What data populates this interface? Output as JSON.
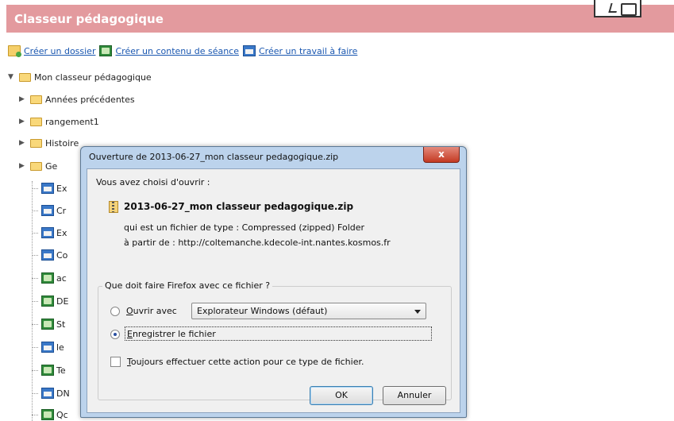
{
  "header": {
    "title": "Classeur pédagogique",
    "color": "#e39a9e"
  },
  "actions": {
    "create_folder": "Créer un dossier",
    "create_content": "Créer un contenu de séance",
    "create_homework": "Créer un travail à faire"
  },
  "tree": {
    "root": "Mon classeur pédagogique",
    "folders": [
      "Années précédentes",
      "rangement1",
      "Histoire",
      "Ge"
    ],
    "items": [
      {
        "label": "Ex",
        "icon": "house-icon"
      },
      {
        "label": "Cr",
        "icon": "house-icon"
      },
      {
        "label": "Ex",
        "icon": "house-icon"
      },
      {
        "label": "Co",
        "icon": "house-icon"
      },
      {
        "label": "ac",
        "icon": "green-icon"
      },
      {
        "label": "DE",
        "icon": "green-icon"
      },
      {
        "label": "St",
        "icon": "green-icon"
      },
      {
        "label": "le",
        "icon": "house-icon"
      },
      {
        "label": "Te",
        "icon": "green-icon"
      },
      {
        "label": "DN",
        "icon": "house-icon"
      },
      {
        "label": "Qc",
        "icon": "green-icon"
      }
    ]
  },
  "dialog": {
    "title": "Ouverture de 2013-06-27_mon classeur pedagogique.zip",
    "close": "x",
    "intro": "Vous avez choisi d'ouvrir :",
    "filename": "2013-06-27_mon classeur pedagogique.zip",
    "type_line": "qui est un fichier de type :  Compressed (zipped) Folder",
    "source_line": "à partir de :  http://coltemanche.kdecole-int.nantes.kosmos.fr",
    "question": "Que doit faire Firefox avec ce fichier ?",
    "open_with": {
      "accel": "O",
      "rest": "uvrir avec"
    },
    "open_with_value": "Explorateur Windows (défaut)",
    "save_file": {
      "accel": "E",
      "rest": "nregistrer le fichier"
    },
    "always": {
      "accel": "T",
      "rest": "oujours effectuer cette action pour ce type de fichier."
    },
    "selected_option": "save_file",
    "always_checked": false,
    "ok": "OK",
    "cancel": "Annuler"
  }
}
